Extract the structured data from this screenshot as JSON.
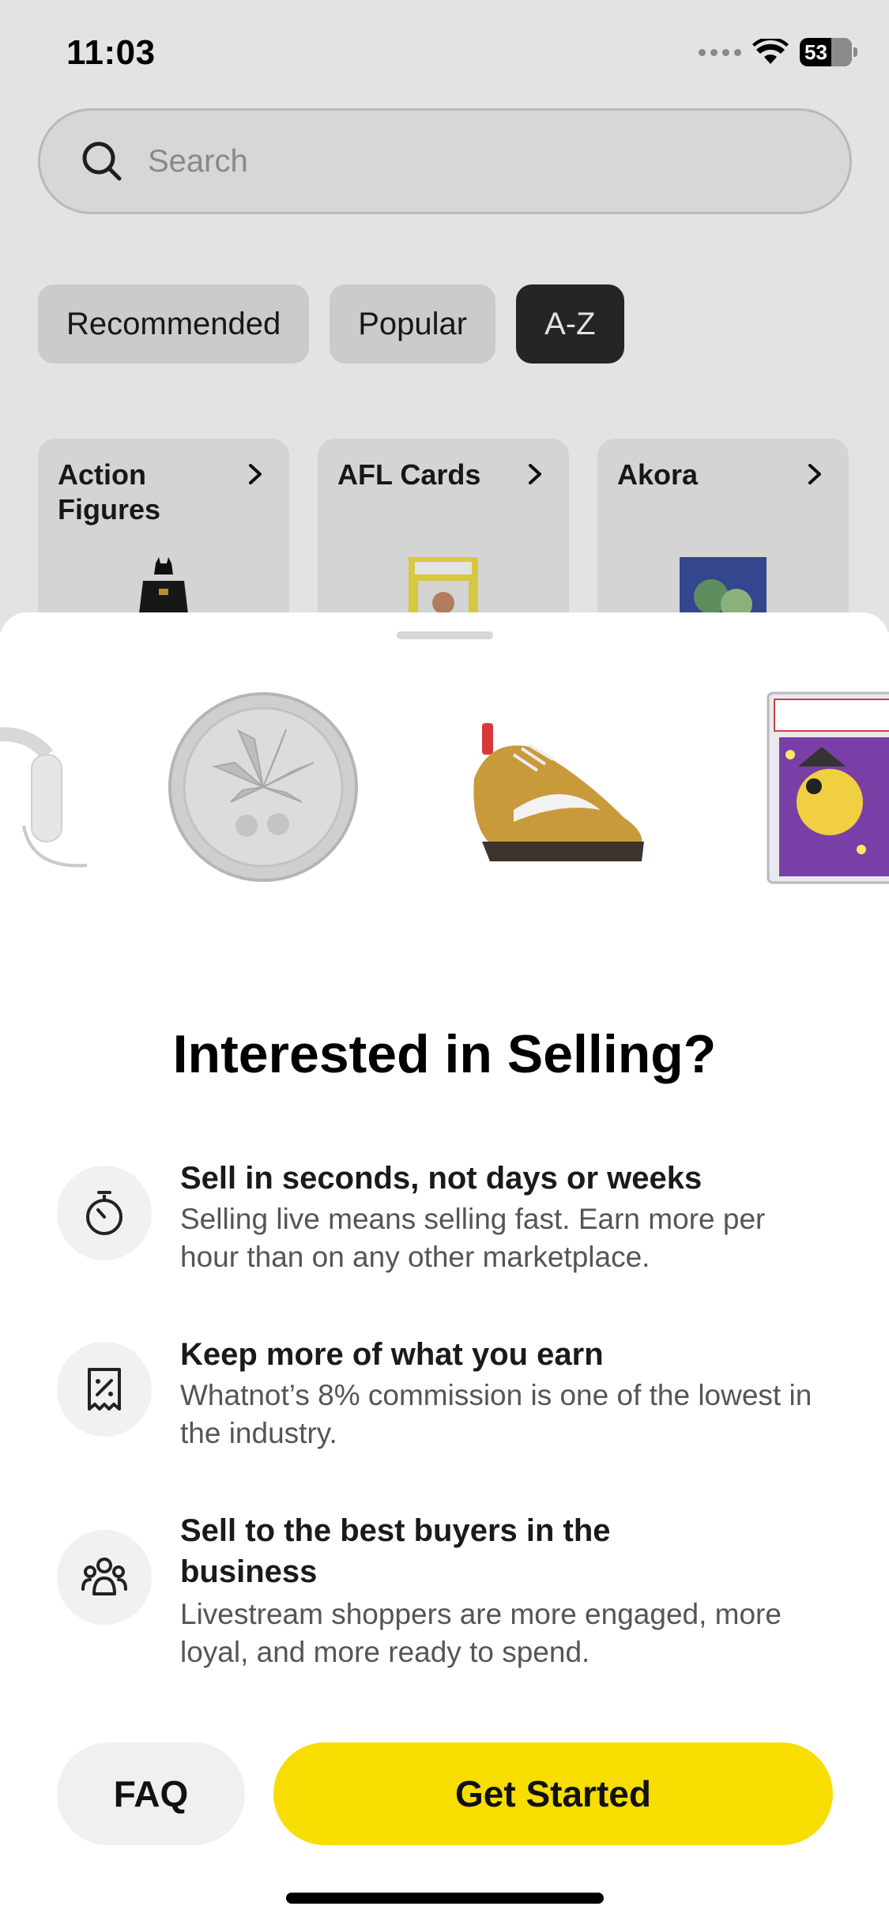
{
  "status_bar": {
    "time": "11:03",
    "battery": "53"
  },
  "search": {
    "placeholder": "Search"
  },
  "chips": [
    "Recommended",
    "Popular",
    "A-Z"
  ],
  "active_chip": "A-Z",
  "categories": [
    {
      "title": "Action Figures"
    },
    {
      "title": "AFL Cards"
    },
    {
      "title": "Akora"
    }
  ],
  "sheet": {
    "title": "Interested in Selling?",
    "features": [
      {
        "icon": "stopwatch-icon",
        "heading": "Sell in seconds, not days or weeks",
        "body": "Selling live means selling fast. Earn more per hour than on any other marketplace."
      },
      {
        "icon": "receipt-percent-icon",
        "heading": "Keep more of what you earn",
        "body": "Whatnot’s 8% commission is one of the lowest in the industry."
      },
      {
        "icon": "people-group-icon",
        "heading": "Sell to the best buyers in the business",
        "body": "Livestream shoppers are more engaged, more loyal, and more ready to spend."
      }
    ],
    "faq_label": "FAQ",
    "cta_label": "Get Started"
  },
  "colors": {
    "accent_yellow": "#f7dd00",
    "active_chip": "#2a2a2a"
  }
}
